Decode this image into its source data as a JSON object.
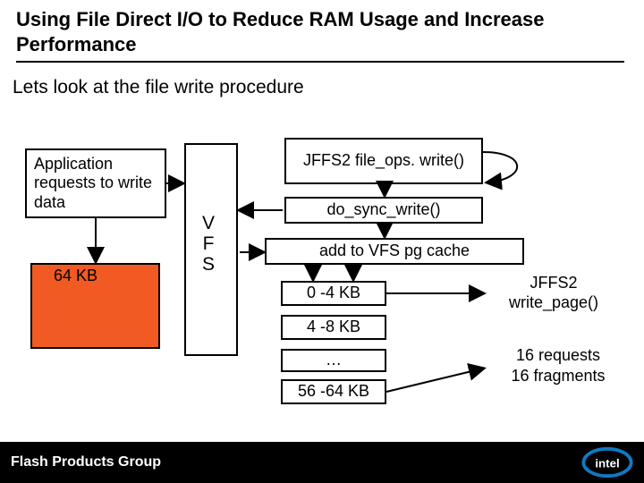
{
  "title": "Using File Direct I/O to Reduce RAM Usage and Increase Performance",
  "subtitle": "Lets look at the file write procedure",
  "app_box": "Application requests to write data",
  "buffer_label": "64 KB",
  "vfs_label_lines": {
    "l1": "V",
    "l2": "F",
    "l3": "S"
  },
  "jffs_fileops": "JFFS2 file_ops. write()",
  "do_sync": "do_sync_write()",
  "vfs_cache": "add to VFS pg cache",
  "segments": {
    "s0": "0 -4 KB",
    "s1": "4 -8 KB",
    "s2": "…",
    "s3": "56 -64 KB"
  },
  "write_page": "JFFS2 write_page()",
  "fragments": {
    "l1": "16 requests",
    "l2": "16 fragments"
  },
  "footer": "Flash Products Group"
}
